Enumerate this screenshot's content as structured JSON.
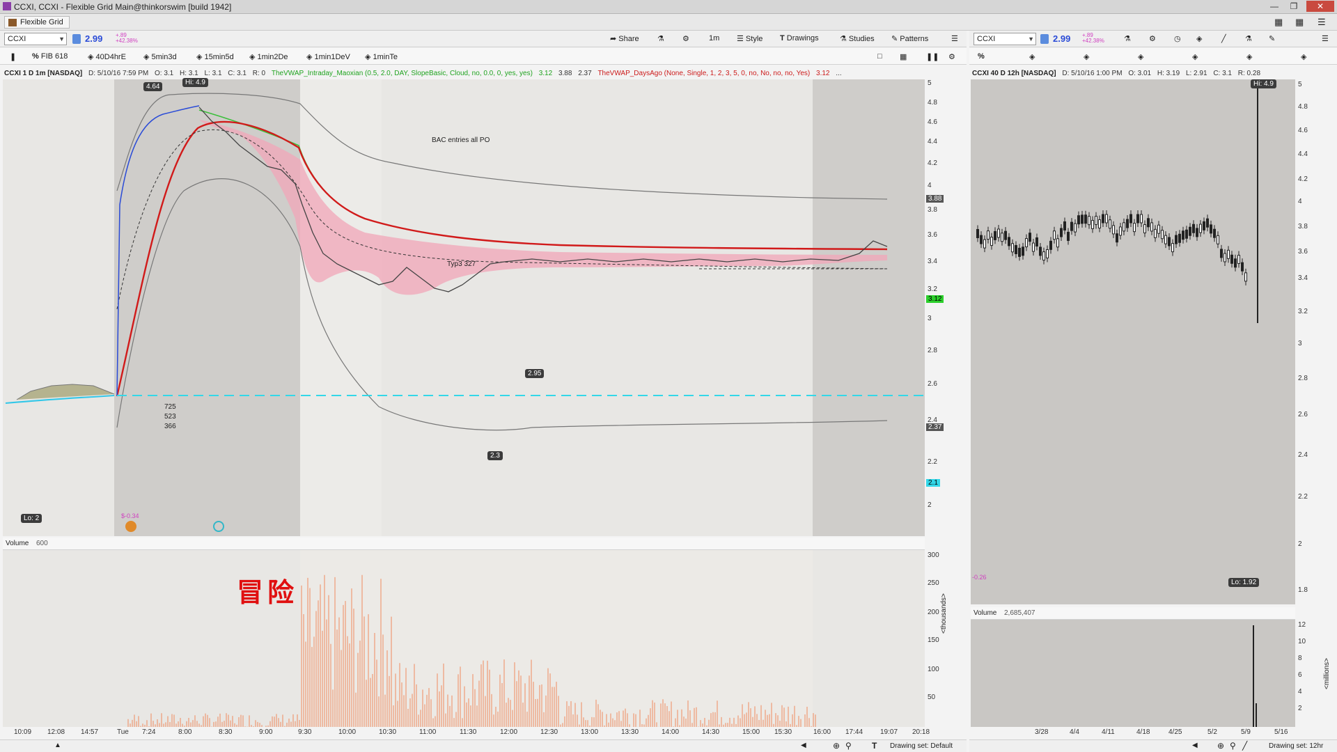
{
  "window": {
    "title": "CCXI, CCXI - Flexible Grid Main@thinkorswim [build 1942]"
  },
  "tab": {
    "label": "Flexible Grid"
  },
  "left": {
    "symbol": "CCXI",
    "last": "2.99",
    "change": "+.89",
    "change_pct": "+42.38%",
    "toolbar": {
      "share": "Share",
      "timeframe": "1m",
      "style": "Style",
      "drawings": "Drawings",
      "studies": "Studies",
      "patterns": "Patterns"
    },
    "studies_bar": [
      "FIB 618",
      "40D4hrE",
      "5min3d",
      "15min5d",
      "1min2De",
      "1min1DeV",
      "1minTe"
    ],
    "header": {
      "symbol": "CCXI 1 D 1m [NASDAQ]",
      "date": "D: 5/10/16 7:59 PM",
      "open": "O: 3.1",
      "high": "H: 3.1",
      "low": "L: 3.1",
      "close": "C: 3.1",
      "range": "R: 0",
      "study1": "TheVWAP_Intraday_Maoxian (0.5, 2.0, DAY, SlopeBasic, Cloud, no, 0.0, 0, yes, yes)",
      "s1v1": "3.12",
      "s1v2": "3.88",
      "s1v3": "2.37",
      "study2": "TheVWAP_DaysAgo (None, Single, 1, 2, 3, 5, 0, no, No, no, no, Yes)",
      "s2v1": "3.12",
      "more": "..."
    },
    "y_ticks": [
      "5",
      "4.8",
      "4.6",
      "4.4",
      "4.2",
      "4",
      "3.8",
      "3.6",
      "3.4",
      "3.2",
      "3",
      "2.8",
      "2.6",
      "2.4",
      "2.2",
      "2"
    ],
    "x_ticks": [
      "10:09",
      "12:08",
      "14:57",
      "Tue",
      "7:24",
      "8:00",
      "8:30",
      "9:00",
      "9:30",
      "10:00",
      "10:30",
      "11:00",
      "11:30",
      "12:00",
      "12:30",
      "13:00",
      "13:30",
      "14:00",
      "14:30",
      "15:00",
      "15:30",
      "16:00",
      "17:44",
      "19:07",
      "20:18"
    ],
    "price_tags": {
      "upper": "3.88",
      "current": "3.12",
      "lower": "2.37",
      "cyan": "2.1"
    },
    "annotations": {
      "high_tag": "4.64",
      "hi_tag": "Hi: 4.9",
      "lo_tag": "Lo: 2",
      "low_295": "2.95",
      "low_23": "2.3",
      "bac_note": "BAC entries all PO",
      "typ_note": "Typ3 327",
      "counts": [
        "725",
        "523",
        "366"
      ],
      "cost_tag": "$-0.34"
    },
    "volume": {
      "label": "Volume",
      "value": "600",
      "y_ticks": [
        "300",
        "250",
        "200",
        "150",
        "100",
        "50"
      ],
      "unit": "<thousands>",
      "overlay": "冒险"
    },
    "bottom": {
      "drawing_set": "Drawing set: Default"
    }
  },
  "right": {
    "symbol": "CCXI",
    "last": "2.99",
    "change": "+.89",
    "change_pct": "+42.38%",
    "header": {
      "symbol": "CCXI 40 D 12h [NASDAQ]",
      "date": "D: 5/10/16 1:00 PM",
      "open": "O: 3.01",
      "high": "H: 3.19",
      "low": "L: 2.91",
      "close": "C: 3.1",
      "range": "R: 0.28"
    },
    "y_ticks": [
      "5",
      "4.8",
      "4.6",
      "4.4",
      "4.2",
      "4",
      "3.8",
      "3.6",
      "3.4",
      "3.2",
      "3",
      "2.8",
      "2.6",
      "2.4",
      "2.2",
      "2",
      "1.8"
    ],
    "x_ticks": [
      "3/28",
      "4/4",
      "4/11",
      "4/18",
      "4/25",
      "5/2",
      "5/9",
      "5/16"
    ],
    "annotations": {
      "hi_tag": "Hi: 4.9",
      "lo_tag": "Lo: 1.92",
      "cost_tag": "-0.26"
    },
    "volume": {
      "label": "Volume",
      "value": "2,685,407",
      "y_ticks": [
        "12",
        "10",
        "8",
        "6",
        "4",
        "2"
      ],
      "unit": "<millions>"
    },
    "bottom": {
      "drawing_set": "Drawing set: 12hr"
    }
  },
  "colors": {
    "vwap_red": "#d11a1a",
    "cloud_pink": "#f2a6b8",
    "cyan": "#33d7e8",
    "price_blue": "#2a4bd7",
    "volume_orange": "#f08a5d",
    "shade_dark": "#cfcdca",
    "shade_light": "#e8e7e4"
  }
}
